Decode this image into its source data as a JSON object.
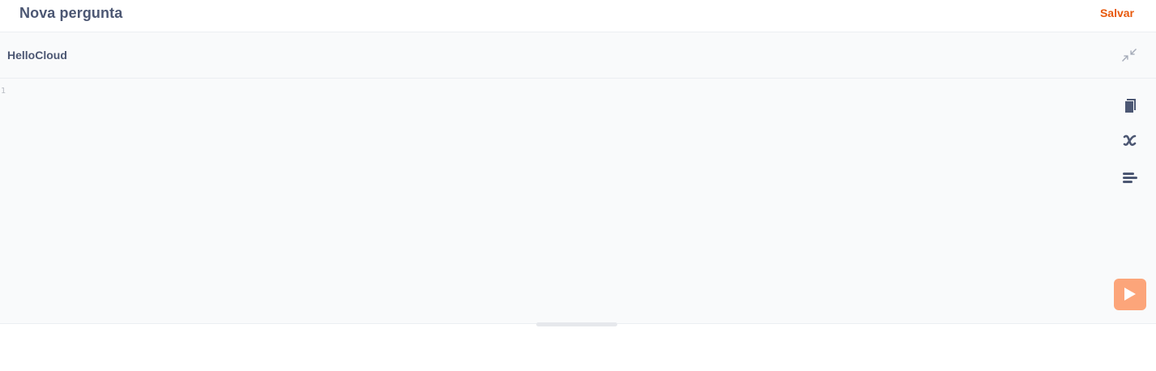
{
  "header": {
    "title": "Nova pergunta",
    "save_label": "Salvar"
  },
  "database": {
    "name": "HelloCloud"
  },
  "editor": {
    "line_numbers": [
      "1"
    ],
    "content": ""
  },
  "icons": {
    "collapse": "collapse-icon",
    "data_reference": "book-icon",
    "variables": "variable-icon",
    "snippets": "snippet-icon",
    "run": "play-icon"
  },
  "colors": {
    "accent": "#e8590c",
    "run_button": "#fca57a",
    "text": "#4c5773",
    "editor_bg": "#f9fafb"
  }
}
